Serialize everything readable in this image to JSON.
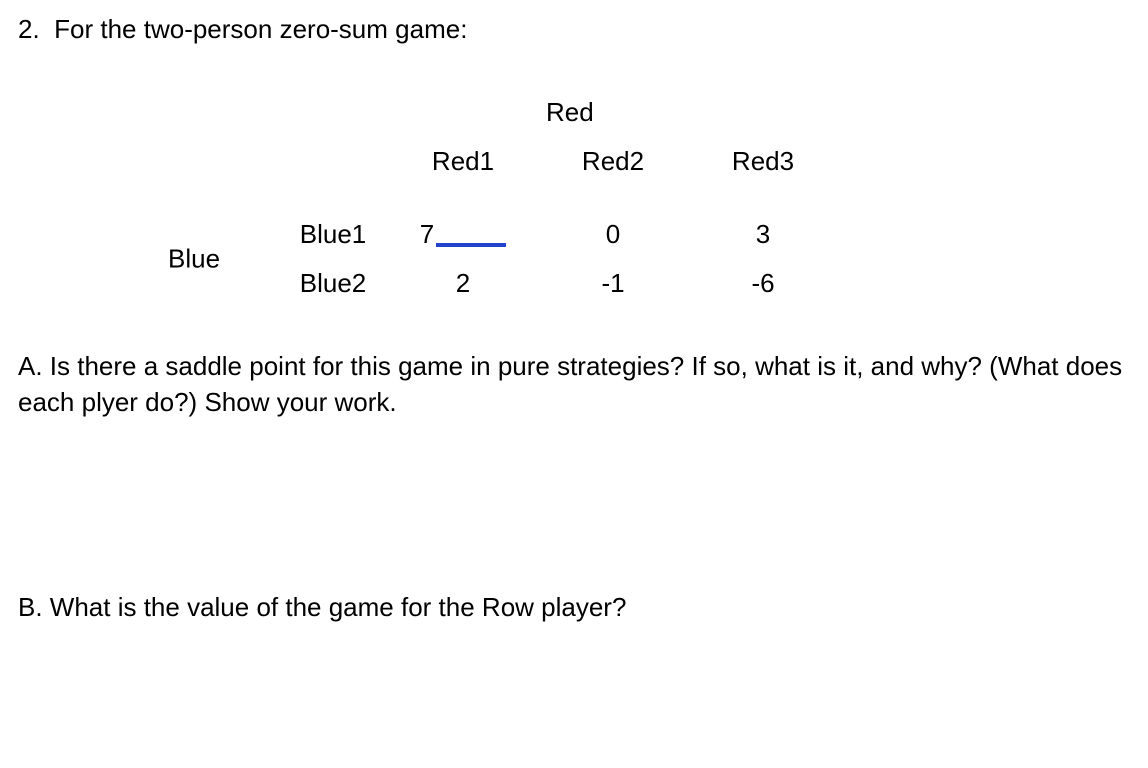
{
  "question": {
    "number": "2.",
    "intro": "For the two-person zero-sum game:"
  },
  "table": {
    "colHeaderGroup": "Red",
    "cols": [
      "Red1",
      "Red2",
      "Red3"
    ],
    "rowHeaderGroup": "Blue",
    "rows": [
      "Blue1",
      "Blue2"
    ],
    "data": [
      [
        "7",
        "0",
        "3"
      ],
      [
        "2",
        "-1",
        "-6"
      ]
    ]
  },
  "parts": {
    "a": "A.  Is there a saddle point for this game in pure strategies?  If so, what is it, and why? (What does each plyer do?)  Show your work.",
    "b": "B.  What is the value of the game for the Row player?"
  }
}
